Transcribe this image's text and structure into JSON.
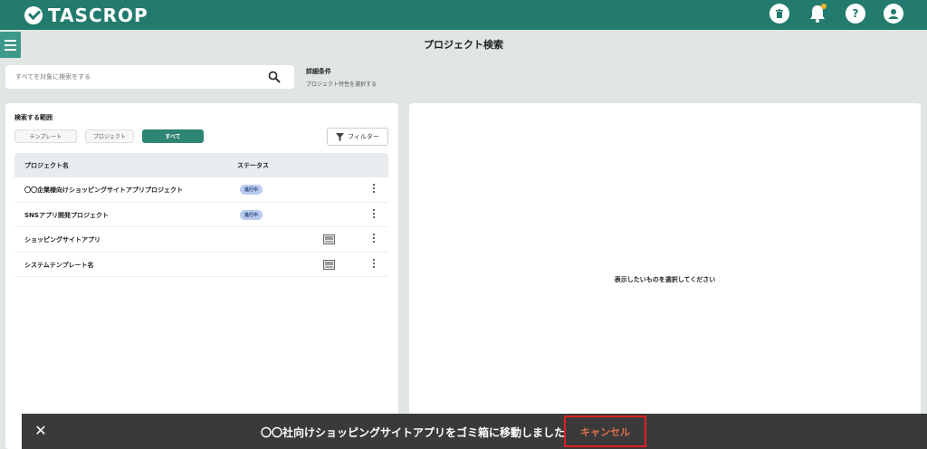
{
  "app": {
    "logo_text": "TASCROP",
    "brand_color": "#237b6e",
    "accent_color": "#2f8575"
  },
  "header_icons": [
    "trash-icon",
    "bell-icon",
    "help-icon",
    "account-icon"
  ],
  "page": {
    "title": "プロジェクト検索"
  },
  "search": {
    "placeholder": "すべてを対象に検索をする",
    "value": ""
  },
  "detail": {
    "title": "詳細条件",
    "subtitle": "プロジェクト特性を選択する"
  },
  "scope": {
    "label": "検索する範囲",
    "options": [
      "テンプレート",
      "プロジェクト",
      "すべて"
    ],
    "selected": "すべて"
  },
  "filter": {
    "label": "フィルター"
  },
  "table": {
    "headers": {
      "name": "プロジェクト名",
      "status": "ステータス"
    },
    "rows": [
      {
        "name": "〇〇企業様向けショッピングサイトアプリプロジェクト",
        "status": "進行中",
        "template": false
      },
      {
        "name": "SNSアプリ開発プロジェクト",
        "status": "進行中",
        "template": false
      },
      {
        "name": "ショッピングサイトアプリ",
        "status": "",
        "template": true
      },
      {
        "name": "システムテンプレート名",
        "status": "",
        "template": true
      }
    ]
  },
  "right_panel": {
    "empty_message": "表示したいものを選択してください"
  },
  "snackbar": {
    "message": "〇〇社向けショッピングサイトアプリをゴミ箱に移動しました",
    "cancel_label": "キャンセル",
    "close_glyph": "✕"
  }
}
